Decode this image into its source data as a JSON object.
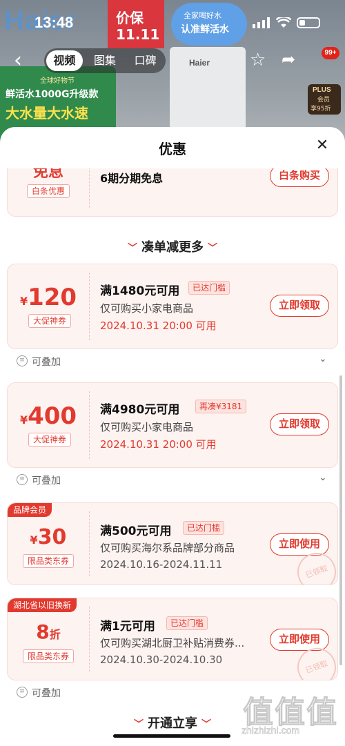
{
  "status_bar": {
    "time": "13:48"
  },
  "background": {
    "brand_logo": "Haier",
    "promo_line1": "价保",
    "promo_line2": "11.11",
    "badge_line1": "全家喝好水",
    "badge_line2": "认准鲜活水",
    "green_line1": "全球好物节",
    "green_line2": "鲜活水1000G升级款",
    "green_line3": "大水量大水速",
    "product_logo": "Haier",
    "plus_line1": "PLUS",
    "plus_line2": "会员",
    "plus_line3": "享95折"
  },
  "nav": {
    "tabs": [
      {
        "label": "视频",
        "active": true
      },
      {
        "label": "图集",
        "active": false
      },
      {
        "label": "口碑",
        "active": false
      }
    ],
    "badge": "99+"
  },
  "sheet": {
    "title": "优惠",
    "top_card": {
      "amount": "免息",
      "tag": "白条优惠",
      "title": "6期分期免息",
      "button": "白条购买"
    },
    "section_title": "凑单减更多",
    "coupons": [
      {
        "currency": "¥",
        "value": "120",
        "tag": "大促神券",
        "title": "满1480元可用",
        "pill": "已达门槛",
        "desc": "仅可购买小家电商品",
        "date": "2024.10.31 20:00 可用",
        "button": "立即领取",
        "stack": "可叠加"
      },
      {
        "currency": "¥",
        "value": "400",
        "tag": "大促神券",
        "title": "满4980元可用",
        "pill": "再凑¥3181",
        "desc": "仅可购买小家电商品",
        "date": "2024.10.31 20:00 可用",
        "button": "立即领取",
        "stack": "可叠加"
      },
      {
        "corner": "品牌会员",
        "currency": "¥",
        "value": "30",
        "tag": "限品类东券",
        "title": "满500元可用",
        "pill": "已达门槛",
        "desc": "仅可购买海尔系品牌部分商品",
        "date": "2024.10.16-2024.11.11",
        "button": "立即使用",
        "stamp": "已领取"
      },
      {
        "corner": "湖北省以旧换新",
        "value": "8",
        "unit": "折",
        "tag": "限品类东券",
        "title": "满1元可用",
        "pill": "已达门槛",
        "desc": "仅可购买湖北厨卫补贴消费券...",
        "date": "2024.10.30-2024.10.30",
        "button": "立即使用",
        "stamp": "已领取",
        "stack": "可叠加"
      }
    ],
    "next_section": "开通立享"
  },
  "watermark": {
    "glyphs": "值值值",
    "domain": "zhizhizhi.com"
  },
  "colors": {
    "accent": "#e23a2e",
    "card_bg": "#fdf3f1"
  }
}
